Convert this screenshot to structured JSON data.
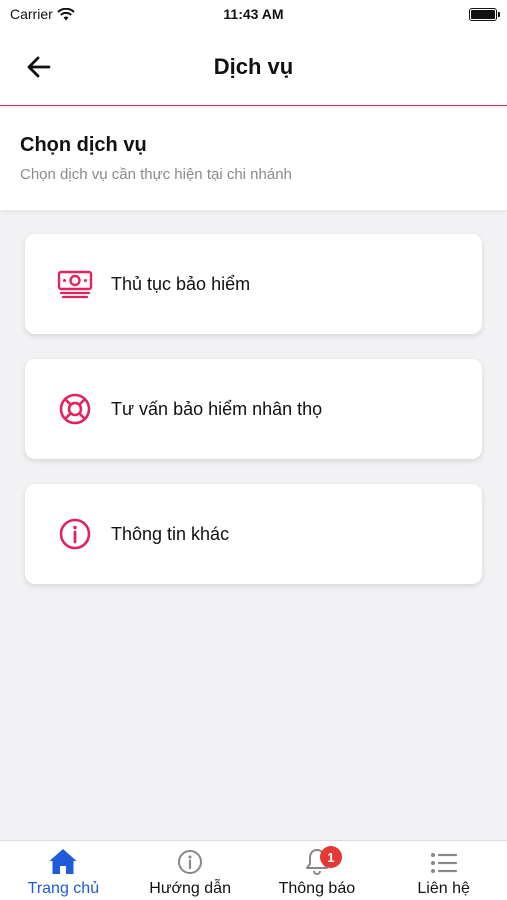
{
  "status_bar": {
    "carrier": "Carrier",
    "time": "11:43 AM"
  },
  "header": {
    "title": "Dịch vụ"
  },
  "section": {
    "title": "Chọn dịch vụ",
    "subtitle": "Chọn dịch vụ cần thực hiện tại chi nhánh"
  },
  "services": [
    {
      "label": "Thủ tục bảo hiểm",
      "icon": "money-icon"
    },
    {
      "label": "Tư vấn bảo hiểm nhân thọ",
      "icon": "lifebuoy-icon"
    },
    {
      "label": "Thông tin khác",
      "icon": "info-icon"
    }
  ],
  "tabs": [
    {
      "label": "Trang chủ",
      "icon": "home-icon",
      "active": true
    },
    {
      "label": "Hướng dẫn",
      "icon": "info-icon"
    },
    {
      "label": "Thông báo",
      "icon": "bell-icon",
      "badge": "1"
    },
    {
      "label": "Liên hệ",
      "icon": "list-icon"
    }
  ],
  "colors": {
    "accent": "#e0245e",
    "active_tab": "#1e5bd8",
    "badge": "#e53935"
  }
}
